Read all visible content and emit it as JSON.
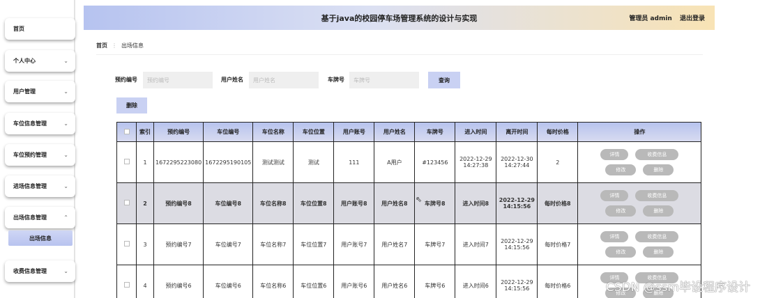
{
  "header": {
    "title": "基于java的校园停车场管理系统的设计与实现",
    "role_user": "管理员 admin",
    "logout": "退出登录"
  },
  "sidebar": {
    "items": [
      {
        "label": "首页",
        "chevron": ""
      },
      {
        "label": "个人中心",
        "chevron": "⌄"
      },
      {
        "label": "用户管理",
        "chevron": "⌄"
      },
      {
        "label": "车位信息管理",
        "chevron": "⌄"
      },
      {
        "label": "车位预约管理",
        "chevron": "⌄"
      },
      {
        "label": "进场信息管理",
        "chevron": "⌄"
      },
      {
        "label": "出场信息管理",
        "chevron": "⌃"
      },
      {
        "label": "收费信息管理",
        "chevron": "⌄"
      }
    ],
    "submenu_active": "出场信息"
  },
  "breadcrumb": {
    "home": "首页",
    "current": "出场信息"
  },
  "search": {
    "reservation_label": "预约编号",
    "reservation_placeholder": "预约编号",
    "reservation_value": "",
    "username_label": "用户姓名",
    "username_placeholder": "用户姓名",
    "username_value": "",
    "plate_label": "车牌号",
    "plate_placeholder": "车牌号",
    "plate_value": "",
    "query_button": "查询"
  },
  "actions": {
    "delete_button": "删除"
  },
  "table": {
    "columns": [
      "",
      "索引",
      "预约编号",
      "车位编号",
      "车位名称",
      "车位位置",
      "用户账号",
      "用户姓名",
      "车牌号",
      "进入时间",
      "离开时间",
      "每时价格",
      "操作"
    ],
    "op_labels": {
      "detail": "详情",
      "fee": "收费信息",
      "edit": "修改",
      "delete": "删除"
    },
    "rows": [
      {
        "index": "1",
        "reservation_no": "1672295223080",
        "space_no": "1672295190105",
        "space_name": "测试测试",
        "space_location": "测试",
        "user_account": "111",
        "user_name": "A用户",
        "plate": "#123456",
        "enter_time": "2022-12-29 14:27:38",
        "leave_time": "2022-12-30 14:27:44",
        "hourly_price": "2"
      },
      {
        "index": "2",
        "reservation_no": "预约编号8",
        "space_no": "车位编号8",
        "space_name": "车位名称8",
        "space_location": "车位位置8",
        "user_account": "用户账号8",
        "user_name": "用户姓名8",
        "plate": "车牌号8",
        "enter_time": "进入时间8",
        "leave_time": "2022-12-29 14:15:56",
        "hourly_price": "每时价格8"
      },
      {
        "index": "3",
        "reservation_no": "预约编号7",
        "space_no": "车位编号7",
        "space_name": "车位名称7",
        "space_location": "车位位置7",
        "user_account": "用户账号7",
        "user_name": "用户姓名7",
        "plate": "车牌号7",
        "enter_time": "进入时间7",
        "leave_time": "2022-12-29 14:15:56",
        "hourly_price": "每时价格7"
      },
      {
        "index": "4",
        "reservation_no": "预约编号6",
        "space_no": "车位编号6",
        "space_name": "车位名称6",
        "space_location": "车位位置6",
        "user_account": "用户账号6",
        "user_name": "用户姓名6",
        "plate": "车牌号6",
        "enter_time": "进入时间6",
        "leave_time": "2022-12-29 14:15:56",
        "hourly_price": "每时价格6"
      }
    ]
  },
  "watermark": "CSDN @ssm毕设程序设计"
}
